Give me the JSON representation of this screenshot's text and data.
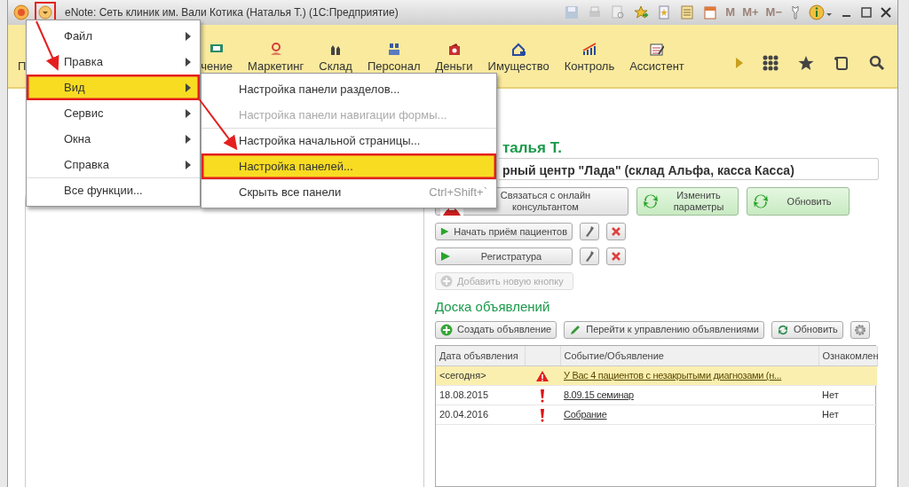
{
  "window": {
    "title": "eNote: Сеть клиник им. Вали Котика (Наталья Т.)  (1С:Предприятие)",
    "menu_button_highlighted": true
  },
  "memory_buttons": {
    "labels": [
      "M",
      "M+",
      "M−"
    ],
    "disabled": true
  },
  "sections": [
    {
      "label": "П"
    },
    {
      "label": "чение"
    },
    {
      "label": "Маркетинг"
    },
    {
      "label": "Склад"
    },
    {
      "label": "Персонал"
    },
    {
      "label": "Деньги"
    },
    {
      "label": "Имущество"
    },
    {
      "label": "Контроль"
    },
    {
      "label": "Ассистент"
    }
  ],
  "main_menu": [
    {
      "label": "Файл",
      "submenu": true,
      "selected": false,
      "separator_before": false
    },
    {
      "label": "Правка",
      "submenu": true,
      "selected": false,
      "separator_before": false
    },
    {
      "label": "Вид",
      "submenu": true,
      "selected": true,
      "separator_before": false
    },
    {
      "label": "Сервис",
      "submenu": true,
      "selected": false,
      "separator_before": false
    },
    {
      "label": "Окна",
      "submenu": true,
      "selected": false,
      "separator_before": false
    },
    {
      "label": "Справка",
      "submenu": true,
      "selected": false,
      "separator_before": false
    },
    {
      "label": "Все функции...",
      "submenu": false,
      "selected": false,
      "separator_before": true
    }
  ],
  "submenu": [
    {
      "label": "Настройка панели разделов...",
      "disabled": false,
      "selected": false,
      "separator_before": false
    },
    {
      "label": "Настройка панели навигации формы...",
      "disabled": true,
      "selected": false,
      "separator_before": false
    },
    {
      "label": "Настройка начальной страницы...",
      "disabled": false,
      "selected": false,
      "separator_before": true
    },
    {
      "label": "Настройка панелей...",
      "disabled": false,
      "selected": true,
      "separator_before": false
    },
    {
      "label": "Скрыть все панели",
      "shortcut": "Ctrl+Shift+`",
      "disabled": false,
      "selected": false,
      "separator_before": true
    }
  ],
  "right_panel": {
    "greeting": "талья Т.",
    "organization": "рный центр \"Лада\" (склад Альфа, касса Касса)",
    "buttons": [
      {
        "label": "Связаться с онлайн консультантом",
        "kind": "plain"
      },
      {
        "label": "Изменить параметры",
        "kind": "green"
      },
      {
        "label": "Обновить",
        "kind": "green"
      }
    ],
    "quick_buttons": [
      {
        "label": "Начать приём пациентов"
      },
      {
        "label": "Регистратура"
      }
    ],
    "add_button": {
      "label": "Добавить новую кнопку",
      "disabled": true
    }
  },
  "board": {
    "title": "Доска объявлений",
    "toolbar": [
      {
        "label": "Создать объявление",
        "kind": "create"
      },
      {
        "label": "Перейти к управлению объявлениями",
        "kind": "edit"
      },
      {
        "label": "Обновить",
        "kind": "refresh"
      },
      {
        "kind": "settings"
      }
    ],
    "columns": [
      "Дата объявления",
      "",
      "Событие/Объявление",
      "Ознакомлен"
    ],
    "rows": [
      {
        "date": "<сегодня>",
        "kind": "warning",
        "event": "У Вас 4 пациентов с незакрытыми диагнозами (н...",
        "acknowledged": "",
        "selected": true
      },
      {
        "date": "18.08.2015",
        "kind": "important",
        "event": "8.09.15 семинар",
        "acknowledged": "Нет",
        "selected": false
      },
      {
        "date": "20.04.2016",
        "kind": "important",
        "event": "Собрание",
        "acknowledged": "Нет",
        "selected": false
      }
    ]
  }
}
